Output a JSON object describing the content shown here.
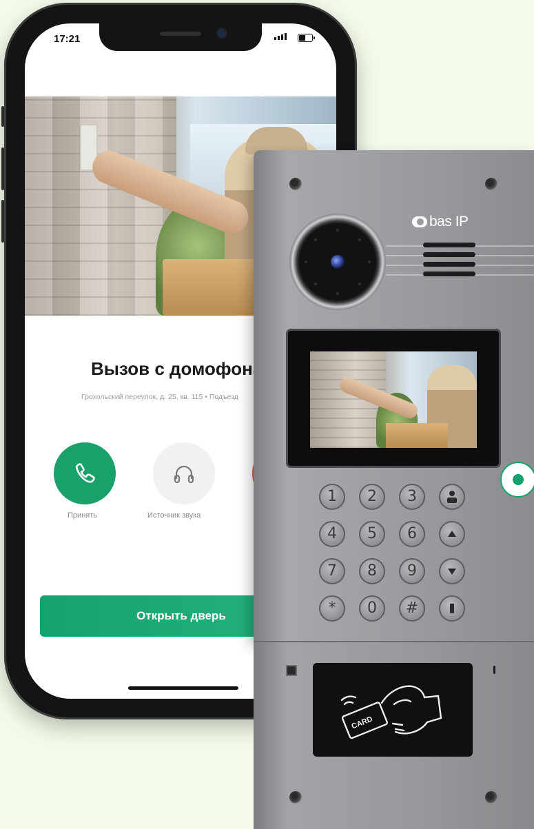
{
  "phone": {
    "status": {
      "time": "17:21"
    },
    "call": {
      "title": "Вызов с домофона",
      "subtitle": "Грохольский переулок, д. 25, кв. 115 • Подъезд"
    },
    "actions": [
      {
        "label": "Принять",
        "icon": "phone-icon"
      },
      {
        "label": "Источник звука",
        "icon": "headphones-icon"
      },
      {
        "label": "",
        "icon": "decline-icon"
      }
    ],
    "open_door": "Открыть дверь"
  },
  "intercom": {
    "brand": "bas IP",
    "keypad": [
      "1",
      "2",
      "3",
      "4",
      "5",
      "6",
      "7",
      "8",
      "9",
      "*",
      "0",
      "#"
    ],
    "side_keys": [
      "concierge-icon",
      "arrow-up-icon",
      "arrow-down-icon",
      "key-icon"
    ],
    "card_label": "CARD"
  },
  "colors": {
    "accent_green": "#1aa06a",
    "decline_red": "#e84e3f",
    "background": "#f2fbea",
    "panel_steel": "#9a9c9f"
  }
}
